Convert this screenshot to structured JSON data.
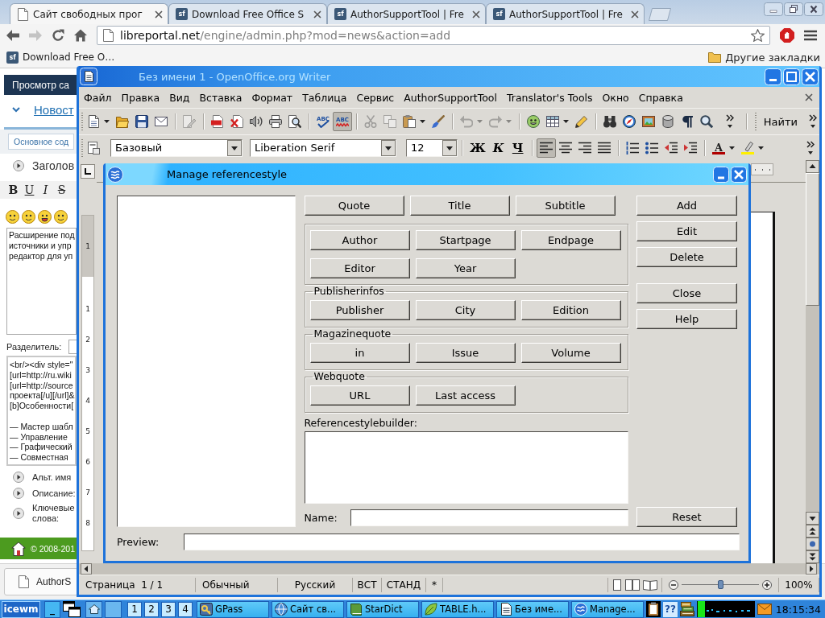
{
  "browser": {
    "tabs": [
      {
        "title": "Сайт свободных прог",
        "selected": true
      },
      {
        "title": "Download Free Office S",
        "favicon_text": "sf",
        "selected": false
      },
      {
        "title": "AuthorSupportTool | Fre",
        "favicon_text": "sf",
        "selected": false
      },
      {
        "title": "AuthorSupportTool | Fre",
        "favicon_text": "sf",
        "selected": false
      }
    ],
    "back": {
      "disabled": false
    },
    "forward": {
      "disabled": true
    },
    "address": {
      "host": "libreportal.net",
      "path": "/engine/admin.php?mod=news&action=add"
    },
    "bookmarks": [
      {
        "label": "Download Free O…",
        "favicon_text": "sf"
      }
    ],
    "other_bookmarks": "Другие закладки",
    "page": {
      "view_site": "Просмотр са",
      "nav_link": "Новост",
      "section_tab": "Основное сод",
      "title_label": "Заголов",
      "format_buttons": [
        {
          "kind": "bold",
          "label": "B"
        },
        {
          "kind": "underline",
          "label": "U"
        },
        {
          "kind": "italic",
          "label": "I"
        },
        {
          "kind": "strike",
          "label": "S"
        }
      ],
      "short_story": [
        "Расширение под",
        "источники и упр",
        "редактор для уп"
      ],
      "separator_label": "Разделитель:",
      "full_story": [
        [
          "<br/><div style=\"",
          "[url=http://ru.wiki",
          "[url=http://source",
          "проекта[/u][/url]&",
          "[b]Особенности["
        ],
        [
          "— Мастер шабл",
          "— Управление",
          "— Графический",
          "— Совместная"
        ]
      ],
      "meta_labels": [
        "Альт. имя",
        "Описание:",
        "Ключевые слова:"
      ],
      "footer": "© 2008-201"
    },
    "downloads": [
      {
        "name": "AuthorS"
      }
    ]
  },
  "writer": {
    "title": "Без имени 1 - OpenOffice.org Writer",
    "menu": [
      "Файл",
      "Правка",
      "Вид",
      "Вставка",
      "Формат",
      "Таблица",
      "Сервис",
      "AuthorSupportTool",
      "Translator's Tools",
      "Окно",
      "Справка"
    ],
    "standard_toolbar": [
      [
        {
          "kind": "new",
          "dropdown": true,
          "disabled": false
        },
        {
          "kind": "open",
          "disabled": false
        },
        {
          "kind": "save",
          "disabled": false
        },
        {
          "kind": "mail",
          "disabled": false
        }
      ],
      [
        {
          "kind": "edit",
          "disabled": true
        }
      ],
      [
        {
          "kind": "pdf",
          "disabled": false
        },
        {
          "kind": "doc_x",
          "disabled": false
        },
        {
          "kind": "sound",
          "disabled": false
        },
        {
          "kind": "print",
          "disabled": false
        },
        {
          "kind": "preview",
          "disabled": false
        }
      ],
      [
        {
          "kind": "spell",
          "label": "ABC",
          "disabled": false
        },
        {
          "kind": "autospell",
          "label": "ABC",
          "disabled": false,
          "pressed": true
        }
      ],
      [
        {
          "kind": "cut",
          "disabled": true
        },
        {
          "kind": "copy",
          "disabled": true
        },
        {
          "kind": "paste",
          "dropdown": true,
          "disabled": false
        },
        {
          "kind": "brush",
          "disabled": false
        }
      ],
      [
        {
          "kind": "undo",
          "dropdown": true,
          "disabled": true
        },
        {
          "kind": "redo",
          "dropdown": true,
          "disabled": true
        }
      ],
      [
        {
          "kind": "face",
          "disabled": false
        },
        {
          "kind": "table",
          "dropdown": true,
          "disabled": false
        },
        {
          "kind": "draw",
          "disabled": false,
          "pressed": false
        }
      ],
      [
        {
          "kind": "binoculars",
          "disabled": false
        },
        {
          "kind": "compass",
          "disabled": false,
          "pressed": false
        },
        {
          "kind": "gallery",
          "disabled": false,
          "pressed": false
        },
        {
          "kind": "database",
          "disabled": false,
          "pressed": false
        },
        {
          "kind": "pilcrow",
          "disabled": false,
          "pressed": false
        },
        {
          "kind": "zoom",
          "disabled": false
        }
      ]
    ],
    "find_label": "Найти",
    "formatting_toolbar": {
      "style": "Базовый",
      "font": "Liberation Serif",
      "size": "12",
      "groups": [
        [
          {
            "kind": "bold",
            "label": "Ж",
            "pressed": false
          },
          {
            "kind": "italic",
            "label": "К",
            "pressed": false
          },
          {
            "kind": "underline",
            "label": "Ч",
            "pressed": false
          }
        ],
        [
          {
            "kind": "align_left",
            "pressed": true
          },
          {
            "kind": "align_center",
            "pressed": false
          },
          {
            "kind": "align_right",
            "pressed": false
          },
          {
            "kind": "justify",
            "pressed": false
          }
        ],
        [
          {
            "kind": "numbering",
            "pressed": false
          },
          {
            "kind": "bullets",
            "pressed": false
          },
          {
            "kind": "outdent"
          },
          {
            "kind": "indent"
          }
        ],
        [
          {
            "kind": "font_color",
            "label": "A",
            "dropdown": true
          },
          {
            "kind": "highlight",
            "dropdown": true
          }
        ]
      ]
    },
    "ruler_marks": [
      "1",
      "1",
      "2",
      "3",
      "4",
      "5",
      "6",
      "7",
      "8"
    ],
    "status": [
      "Страница  1 / 1",
      "Обычный",
      "Русский",
      "ВСТ",
      "СТАНД",
      "*"
    ],
    "zoom": {
      "level": 0.5,
      "label": "100%"
    }
  },
  "dialog": {
    "title": "Manage referencestyle",
    "field_buttons": [
      "Quote",
      "Title",
      "Subtitle"
    ],
    "groups": [
      {
        "buttons": [
          "Author",
          "Startpage",
          "Endpage",
          "Editor",
          "Year"
        ]
      },
      {
        "label": "Publisherinfos",
        "buttons": [
          "Publisher",
          "City",
          "Edition"
        ]
      },
      {
        "label": "Magazinequote",
        "buttons": [
          "in",
          "Issue",
          "Volume"
        ]
      },
      {
        "label": "Webquote",
        "buttons": [
          "URL",
          "Last access"
        ]
      }
    ],
    "builder_label": "Referencestylebuilder:",
    "name_label": "Name:",
    "list_buttons": [
      "Add",
      "Edit",
      "Delete"
    ],
    "window_buttons": [
      "Close",
      "Help"
    ],
    "reset": "Reset",
    "preview_label": "Preview:"
  },
  "taskbar": {
    "start": "icewm",
    "show_desktop": "_",
    "workspaces": [
      "1",
      "2",
      "3",
      "4"
    ],
    "tasks": [
      {
        "label": "GPass",
        "kind": "keys"
      },
      {
        "label": "Сайт св...",
        "kind": "globe"
      },
      {
        "label": "StarDict",
        "kind": "book"
      },
      {
        "label": "TABLE.h...",
        "kind": "leaf"
      },
      {
        "label": "Без име...",
        "kind": "writer"
      },
      {
        "label": "Manage...",
        "kind": "dialog"
      }
    ],
    "tray_help": "??",
    "clock": "18:15:34"
  }
}
